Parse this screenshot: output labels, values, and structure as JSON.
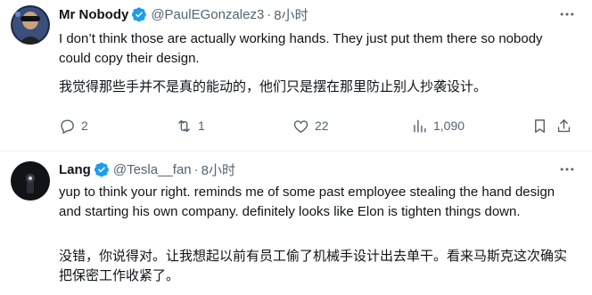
{
  "tweets": [
    {
      "author": "Mr Nobody",
      "handle": "@PaulEGonzalez3",
      "separator": "·",
      "time": "8小时",
      "text_en": "I don’t think those are actually working hands. They just put them there so nobody could copy their design.",
      "text_zh": "我觉得那些手并不是真的能动的，他们只是摆在那里防止别人抄袭设计。",
      "stats": {
        "replies": "2",
        "retweets": "1",
        "likes": "22",
        "views": "1,090"
      },
      "icons": [
        "reply-icon",
        "retweet-icon",
        "like-icon",
        "views-icon",
        "bookmark-icon",
        "share-icon"
      ]
    },
    {
      "author": "Lang",
      "handle": "@Tesla__fan",
      "separator": "·",
      "time": "8小时",
      "text_en": "yup to think your right. reminds me of some past employee stealing the hand design and starting his own company. definitely looks like Elon is tighten things down.",
      "text_zh": "没错，你说得对。让我想起以前有员工偷了机械手设计出去单干。看来马斯克这次确实把保密工作收紧了。"
    }
  ],
  "colors": {
    "verified": "#1d9bf0",
    "secondary_text": "#536471",
    "primary_text": "#0f1419"
  }
}
